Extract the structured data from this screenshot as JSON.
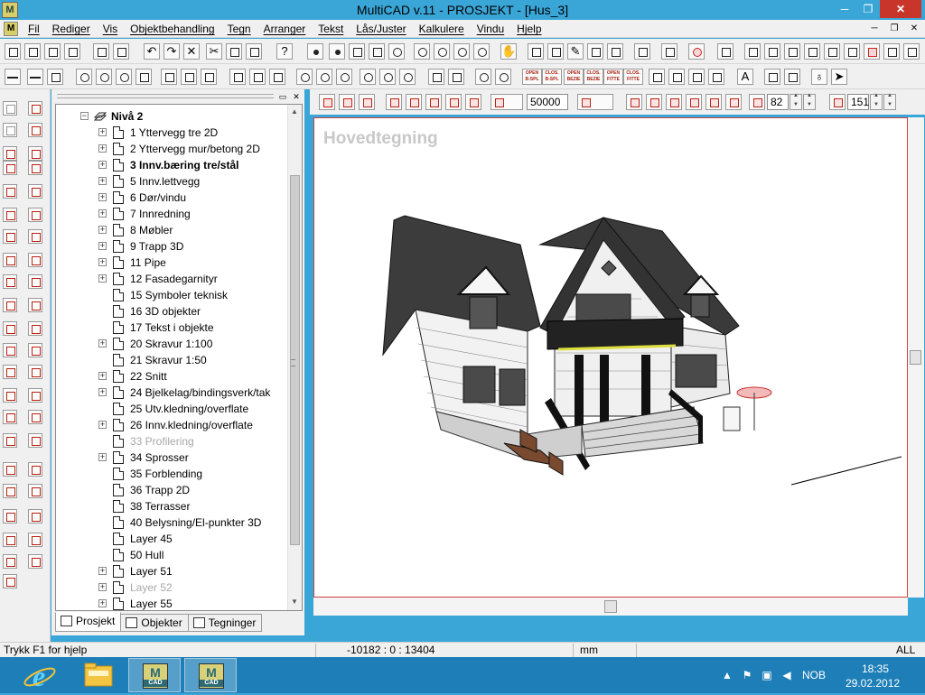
{
  "window": {
    "title": "MultiCAD v.11 - PROSJEKT - [Hus_3]",
    "app_icon_letter": "M",
    "minimize_glyph": "─",
    "maximize_glyph": "❐",
    "close_glyph": "✕"
  },
  "menu": {
    "items": [
      "Fil",
      "Rediger",
      "Vis",
      "Objektbehandling",
      "Tegn",
      "Arranger",
      "Tekst",
      "Lås/Juster",
      "Kalkulere",
      "Vindu",
      "Hjelp"
    ],
    "mdi_minimize": "─",
    "mdi_restore": "❐",
    "mdi_close": "✕"
  },
  "toolbar2_labels": [
    "OPEN B-SPL",
    "CLOS. B-SPL",
    "OPEN BEZIE",
    "CLOS. BEZIE",
    "OPEN FITTE",
    "CLOS. FITTE"
  ],
  "tree": {
    "level_label": "Nivå 2",
    "rows": [
      {
        "label": "1 Yttervegg tre 2D",
        "expander": true,
        "style": ""
      },
      {
        "label": "2 Yttervegg mur/betong 2D",
        "expander": true,
        "style": ""
      },
      {
        "label": "3 Innv.bæring tre/stål",
        "expander": true,
        "style": "bold"
      },
      {
        "label": "5 Innv.lettvegg",
        "expander": true,
        "style": ""
      },
      {
        "label": "6 Dør/vindu",
        "expander": true,
        "style": ""
      },
      {
        "label": "7 Innredning",
        "expander": true,
        "style": ""
      },
      {
        "label": "8 Møbler",
        "expander": true,
        "style": ""
      },
      {
        "label": "9 Trapp 3D",
        "expander": true,
        "style": ""
      },
      {
        "label": "11 Pipe",
        "expander": true,
        "style": ""
      },
      {
        "label": "12 Fasadegarnityr",
        "expander": true,
        "style": ""
      },
      {
        "label": "15 Symboler teknisk",
        "expander": false,
        "style": ""
      },
      {
        "label": "16 3D objekter",
        "expander": false,
        "style": ""
      },
      {
        "label": "17 Tekst i objekte",
        "expander": false,
        "style": ""
      },
      {
        "label": "20 Skravur 1:100",
        "expander": true,
        "style": ""
      },
      {
        "label": "21 Skravur 1:50",
        "expander": false,
        "style": ""
      },
      {
        "label": "22 Snitt",
        "expander": true,
        "style": ""
      },
      {
        "label": "24 Bjelkelag/bindingsverk/tak",
        "expander": true,
        "style": ""
      },
      {
        "label": "25 Utv.kledning/overflate",
        "expander": false,
        "style": ""
      },
      {
        "label": "26 Innv.kledning/overflate",
        "expander": true,
        "style": ""
      },
      {
        "label": "33 Profilering",
        "expander": false,
        "style": "dim"
      },
      {
        "label": "34 Sprosser",
        "expander": true,
        "style": ""
      },
      {
        "label": "35 Forblending",
        "expander": false,
        "style": ""
      },
      {
        "label": "36 Trapp 2D",
        "expander": false,
        "style": ""
      },
      {
        "label": "38 Terrasser",
        "expander": false,
        "style": ""
      },
      {
        "label": "40 Belysning/El-punkter 3D",
        "expander": false,
        "style": ""
      },
      {
        "label": "Layer 45",
        "expander": false,
        "style": ""
      },
      {
        "label": "50 Hull",
        "expander": false,
        "style": ""
      },
      {
        "label": "Layer 51",
        "expander": true,
        "style": ""
      },
      {
        "label": "Layer 52",
        "expander": true,
        "style": "dim"
      },
      {
        "label": "Layer 55",
        "expander": true,
        "style": ""
      }
    ]
  },
  "tabs": [
    {
      "label": "Prosjekt",
      "active": true
    },
    {
      "label": "Objekter",
      "active": false
    },
    {
      "label": "Tegninger",
      "active": false
    }
  ],
  "drawing_toolbar": {
    "scale_value": "50000",
    "angle_x": "82",
    "angle_z": "151"
  },
  "canvas": {
    "title": "Hovedtegning"
  },
  "status": {
    "help": "Trykk F1 for hjelp",
    "coords": "-10182 : 0 : 13404",
    "unit": "mm",
    "mode": "ALL"
  },
  "taskbar": {
    "app1_label": "CAD",
    "app2_label": "CAD",
    "app_letter": "M",
    "language": "NOB",
    "time": "18:35",
    "date": "29.02.2012"
  },
  "colors": {
    "titlebar": "#3aa6d8",
    "close": "#c7352b",
    "taskbar": "#1e7fb8",
    "canvas_border": "#d04040"
  }
}
